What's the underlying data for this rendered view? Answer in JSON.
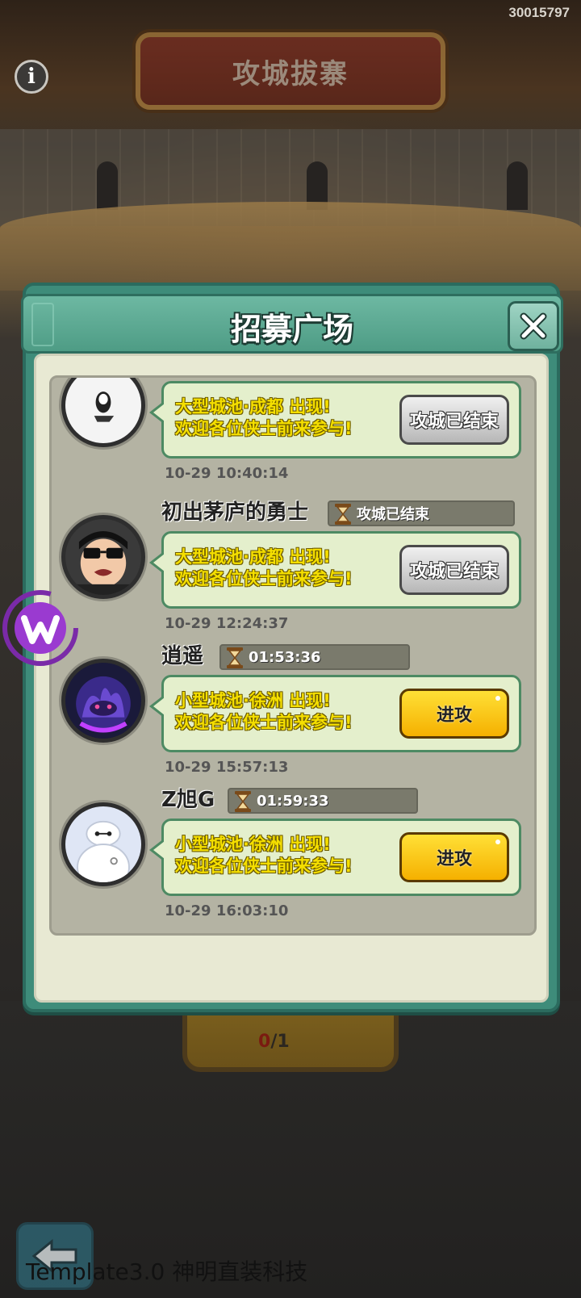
{
  "top_id": "30015797",
  "game_title": "攻城拔寨",
  "behind_button": {
    "count_used": "0",
    "count_sep": "/1"
  },
  "watermark": "Template3.0 神明直装科技",
  "dialog": {
    "title": "招募广场",
    "entries": [
      {
        "player_name": "",
        "timer": "",
        "line1": "大型城池·成都 出现!",
        "line2": "欢迎各位侠士前来参与!",
        "button": "攻城已结束",
        "button_state": "ended",
        "time": "10-29 10:40:14",
        "avatar": "white-mask-avatar"
      },
      {
        "player_name": "初出茅庐的勇士",
        "timer": "攻城已结束",
        "line1": "大型城池·成都 出现!",
        "line2": "欢迎各位侠士前来参与!",
        "button": "攻城已结束",
        "button_state": "ended",
        "time": "10-29 12:24:37",
        "avatar": "sunglasses-man-avatar"
      },
      {
        "player_name": "逍遥",
        "timer": "01:53:36",
        "line1": "小型城池·徐洲 出现!",
        "line2": "欢迎各位侠士前来参与!",
        "button": "进攻",
        "button_state": "attack",
        "time": "10-29 15:57:13",
        "avatar": "purple-flame-avatar"
      },
      {
        "player_name": "Z旭G",
        "timer": "01:59:33",
        "line1": "小型城池·徐洲 出现!",
        "line2": "欢迎各位侠士前来参与!",
        "button": "进攻",
        "button_state": "attack",
        "time": "10-29 16:03:10",
        "avatar": "white-robot-avatar"
      }
    ]
  },
  "colors": {
    "dialog_frame": "#3e8c7a",
    "bubble_bg": "#e4efcc",
    "attack_yellow": "#f5b000",
    "text_yellow": "#f5df00"
  }
}
